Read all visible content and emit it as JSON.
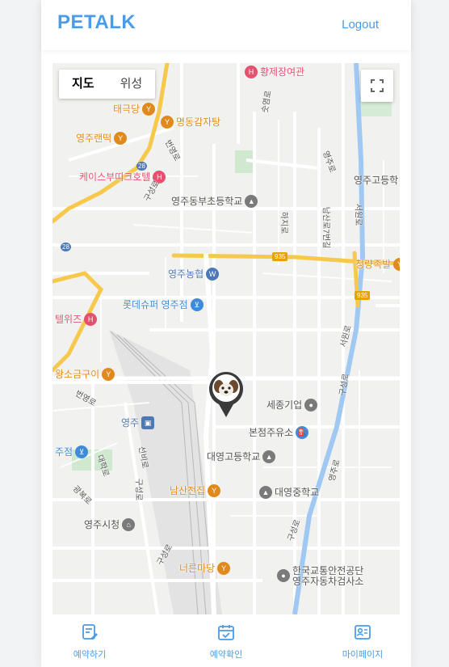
{
  "header": {
    "brand": "PETALK",
    "logout_label": "Logout"
  },
  "map": {
    "type_controls": {
      "map_label": "지도",
      "satellite_label": "위성"
    },
    "pois": [
      {
        "name": "황제장여관",
        "icon": "hotel-icon",
        "color": "#e5506f"
      },
      {
        "name": "태극당",
        "icon": "restaurant-icon",
        "color": "#e08a1e"
      },
      {
        "name": "명동감자탕",
        "icon": "restaurant-icon",
        "color": "#e08a1e"
      },
      {
        "name": "영주랜떡",
        "icon": "restaurant-icon",
        "color": "#e08a1e"
      },
      {
        "name": "케이스부띠크호텔",
        "icon": "hotel-icon",
        "color": "#e5506f"
      },
      {
        "name": "영주동부초등학교",
        "icon": "school-icon",
        "color": "#666666"
      },
      {
        "name": "영주고등학",
        "icon": "school-icon",
        "color": "#666666"
      },
      {
        "name": "영주농협",
        "icon": "bank-icon",
        "color": "#4e78b5"
      },
      {
        "name": "롯데슈퍼 영주점",
        "icon": "shopping-icon",
        "color": "#3f8bd9"
      },
      {
        "name": "청량족발",
        "icon": "restaurant-icon",
        "color": "#e08a1e"
      },
      {
        "name": "텔위즈",
        "icon": "hotel-icon",
        "color": "#e5506f"
      },
      {
        "name": "왕소금구이",
        "icon": "restaurant-icon",
        "color": "#e08a1e"
      },
      {
        "name": "세종기업",
        "icon": "place-icon",
        "color": "#666666"
      },
      {
        "name": "영주",
        "icon": "train-icon",
        "color": "#4e78b5"
      },
      {
        "name": "본점주유소",
        "icon": "gas-station-icon",
        "color": "#3f8bd9"
      },
      {
        "name": "주점",
        "icon": "shopping-icon",
        "color": "#3f8bd9"
      },
      {
        "name": "대영고등학교",
        "icon": "school-icon",
        "color": "#666666"
      },
      {
        "name": "남산전집",
        "icon": "bar-icon",
        "color": "#e08a1e"
      },
      {
        "name": "대영중학교",
        "icon": "school-icon",
        "color": "#666666"
      },
      {
        "name": "영주시청",
        "icon": "city-hall-icon",
        "color": "#666666"
      },
      {
        "name": "너른마당",
        "icon": "restaurant-icon",
        "color": "#e08a1e"
      },
      {
        "name": "한국교통안전공단\n영주자동차검사소",
        "icon": "place-icon",
        "color": "#666666"
      }
    ],
    "road_labels": [
      "번영로",
      "구성로",
      "영주로",
      "서원로",
      "남산로7번길",
      "구성로",
      "선비로",
      "대학로",
      "광복로",
      "번영로",
      "구성로",
      "서원로",
      "구성로",
      "구성로",
      "숫염로",
      "하지로",
      "영주로"
    ],
    "shields": [
      "28",
      "28",
      "935",
      "935"
    ]
  },
  "bottom_nav": {
    "items": [
      {
        "label": "예약하기",
        "icon": "reserve-edit-icon"
      },
      {
        "label": "예약확인",
        "icon": "calendar-check-icon"
      },
      {
        "label": "마이페이지",
        "icon": "profile-card-icon"
      }
    ]
  },
  "colors": {
    "brand": "#4a9be8",
    "major_road": "#f6c94d",
    "water": "#9fc8f2"
  }
}
